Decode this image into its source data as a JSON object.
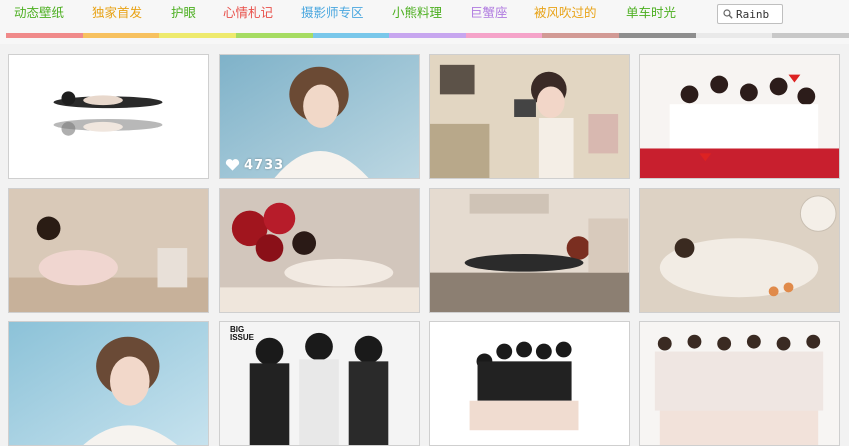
{
  "nav": {
    "items": [
      {
        "label": "动态壁纸",
        "color": "#4caf20"
      },
      {
        "label": "独家首发",
        "color": "#e8a317"
      },
      {
        "label": "护眼",
        "color": "#4caf20"
      },
      {
        "label": "心情札记",
        "color": "#e8504a"
      },
      {
        "label": "摄影师专区",
        "color": "#4aa7df"
      },
      {
        "label": "小熊料理",
        "color": "#4caf20"
      },
      {
        "label": "巨蟹座",
        "color": "#b07be0"
      },
      {
        "label": "被风吹过的",
        "color": "#e8a317"
      },
      {
        "label": "单车时光",
        "color": "#4caf20"
      }
    ],
    "strip_colors": [
      "#f08a8a",
      "#f7c15f",
      "#eeea6d",
      "#a6dc62",
      "#79c7ea",
      "#c7a6ef",
      "#f5a3c9",
      "#d29a95",
      "#8e8e8e",
      "#e9e9e9",
      "#c8c8c8"
    ]
  },
  "search": {
    "value": "Rainb",
    "icon": "search-icon"
  },
  "photos": [
    {
      "id": "photo-1",
      "desc": "woman lying with reflection on white",
      "likes": ""
    },
    {
      "id": "photo-2",
      "desc": "short-haired woman portrait",
      "likes": "4733"
    },
    {
      "id": "photo-3",
      "desc": "woman with vintage camera",
      "likes": ""
    },
    {
      "id": "photo-4",
      "desc": "group posing with red hearts",
      "likes": ""
    },
    {
      "id": "photo-5",
      "desc": "woman at dessert table",
      "likes": ""
    },
    {
      "id": "photo-6",
      "desc": "woman lying on bed with red balloons",
      "likes": ""
    },
    {
      "id": "photo-7",
      "desc": "woman lying on bar counter",
      "likes": ""
    },
    {
      "id": "photo-8",
      "desc": "woman lying on white sofa",
      "likes": ""
    },
    {
      "id": "photo-9",
      "desc": "short-haired woman portrait blue",
      "likes": ""
    },
    {
      "id": "photo-10",
      "desc": "magazine cover black and white",
      "likes": ""
    },
    {
      "id": "photo-11",
      "desc": "group in black outfits",
      "likes": ""
    },
    {
      "id": "photo-12",
      "desc": "group in white dresses",
      "likes": ""
    }
  ],
  "magazine_text": "BIG ISSUE"
}
